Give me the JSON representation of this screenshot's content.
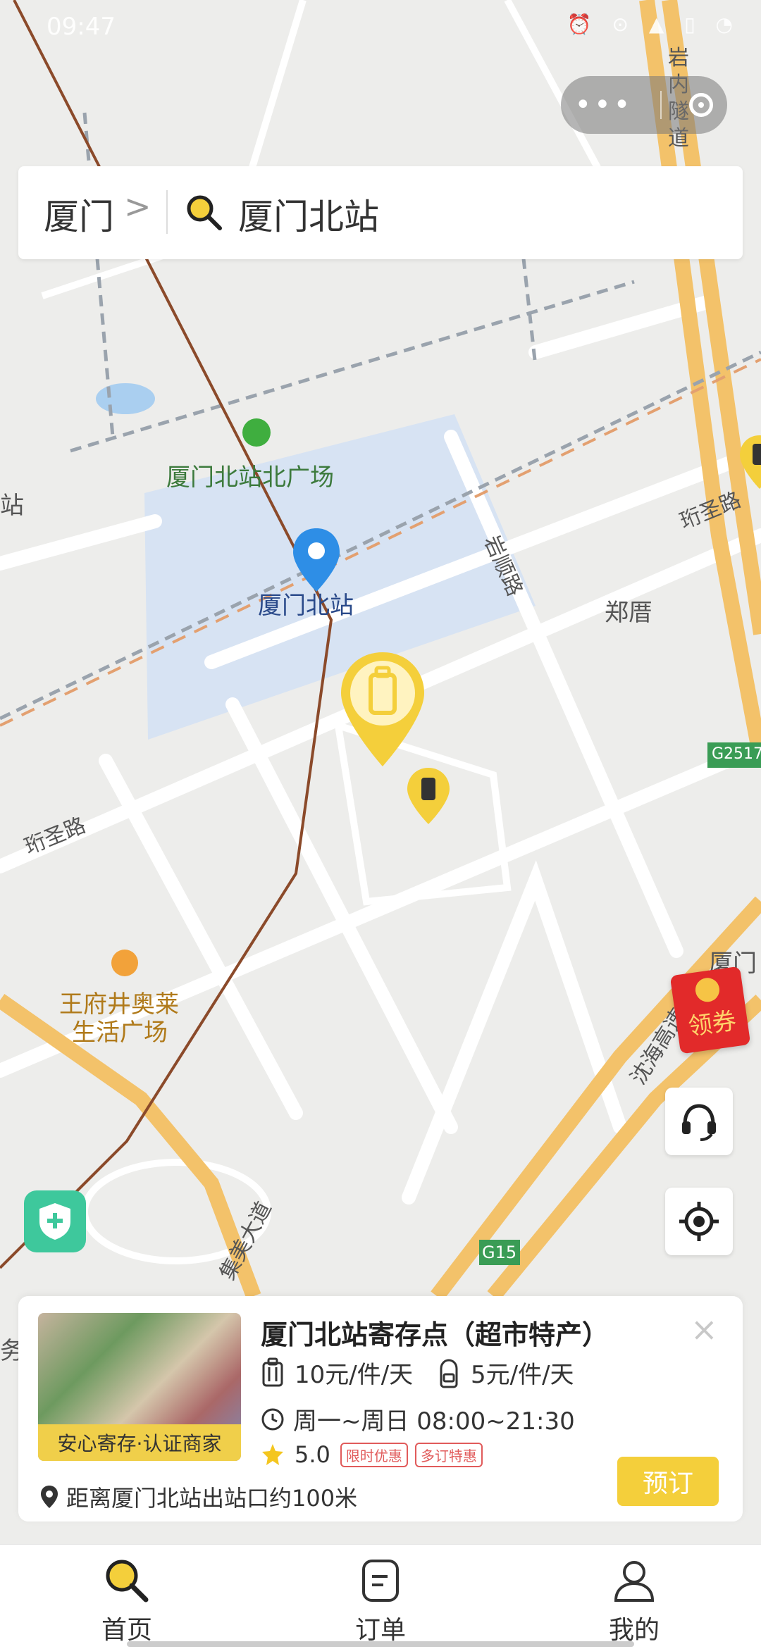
{
  "status_bar": {
    "time": "09:47",
    "icons": "⏰ ⊙ ▲ ▯ ◔"
  },
  "capsule": {
    "dots": "•••"
  },
  "search": {
    "city": "厦门",
    "chevron": ">",
    "query": "厦门北站"
  },
  "map": {
    "labels": {
      "station_plaza": "厦门北站北广场",
      "station": "厦门北站",
      "zhengcuo": "郑厝",
      "yanshun_road": "岩顺路",
      "jisheng_road_left": "珩圣路",
      "jisheng_road_right": "珩圣路",
      "wangfujing_1": "王府井奥莱",
      "wangfujing_2": "生活广场",
      "yannei_tunnel": "岩内隧道",
      "jimei_avenue": "集美大道",
      "xiamen_right": "厦门",
      "expressway": "沈海高速",
      "g2517": "G2517",
      "g15": "G15",
      "left_edge_top": "站",
      "left_edge_bottom": "务"
    },
    "colors": {
      "background": "#ededeb",
      "station_area": "#d7e3f3",
      "highway": "#f3c26a",
      "rail": "#8b4a2a",
      "pin": "#f4cf3b",
      "location_pin": "#2e8ee6"
    }
  },
  "coupon": {
    "label": "领券"
  },
  "card": {
    "title": "厦门北站寄存点（超市特产）",
    "thumb_badge": "安心寄存·认证商家",
    "price_large": "10元/件/天",
    "price_small": "5元/件/天",
    "hours": "周一~周日 08:00~21:30",
    "rating": "5.0",
    "tags": [
      "限时优惠",
      "多订特惠"
    ],
    "distance": "距离厦门北站出站口约100米",
    "book_label": "预订",
    "close": "×"
  },
  "tabs": [
    {
      "label": "首页",
      "icon": "search-icon"
    },
    {
      "label": "订单",
      "icon": "order-icon"
    },
    {
      "label": "我的",
      "icon": "user-icon"
    }
  ]
}
